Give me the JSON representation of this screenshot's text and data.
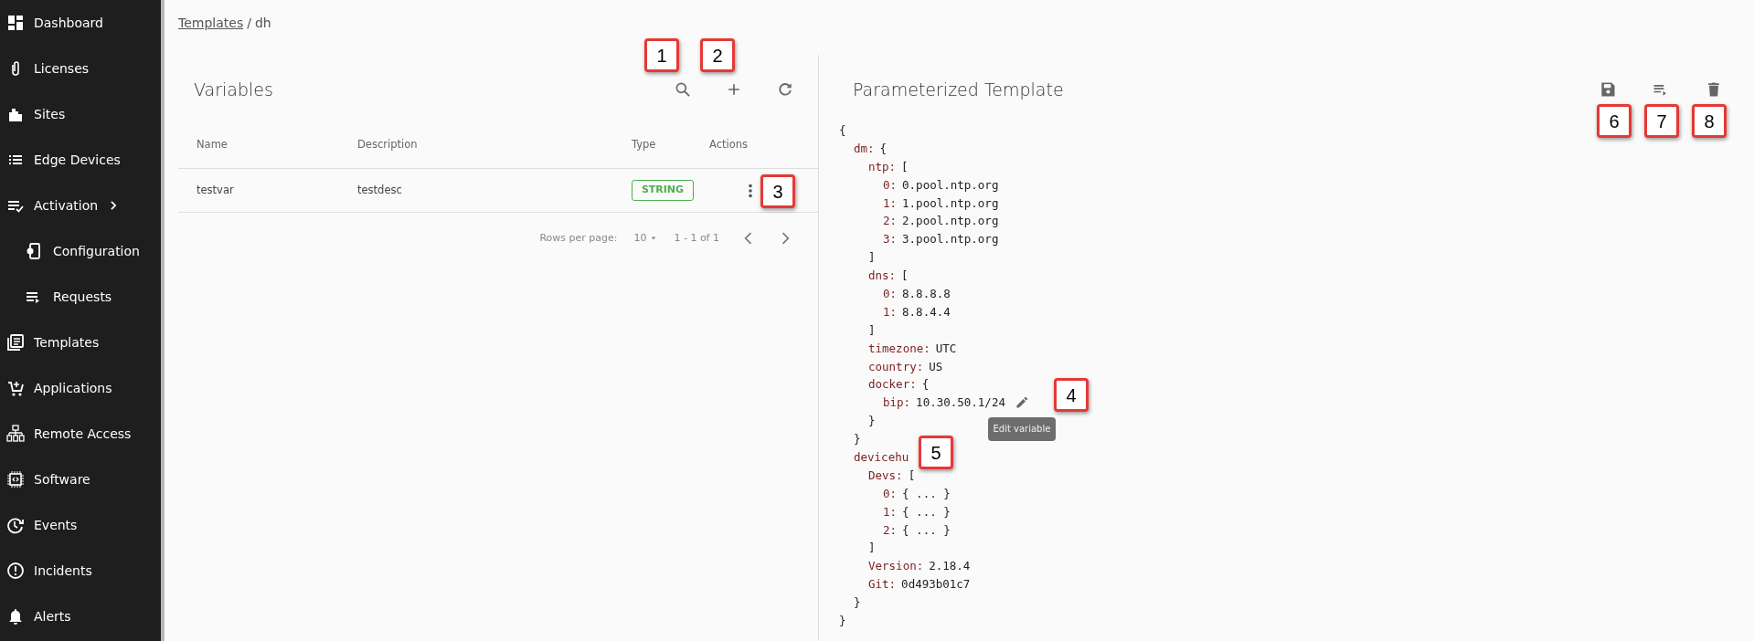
{
  "sidebar": {
    "items": [
      {
        "label": "Dashboard"
      },
      {
        "label": "Licenses"
      },
      {
        "label": "Sites"
      },
      {
        "label": "Edge Devices"
      },
      {
        "label": "Activation",
        "expanded": true,
        "children": [
          {
            "label": "Configuration"
          },
          {
            "label": "Requests"
          }
        ]
      },
      {
        "label": "Templates"
      },
      {
        "label": "Applications"
      },
      {
        "label": "Remote Access"
      },
      {
        "label": "Software"
      },
      {
        "label": "Events"
      },
      {
        "label": "Incidents"
      },
      {
        "label": "Alerts"
      }
    ]
  },
  "breadcrumb": {
    "link": "Templates",
    "separator": "/",
    "current": "dh"
  },
  "variables": {
    "title": "Variables",
    "columns": [
      "Name",
      "Description",
      "Type",
      "Actions"
    ],
    "rows": [
      {
        "name": "testvar",
        "description": "testdesc",
        "type": "STRING"
      }
    ],
    "pagination": {
      "rows_per_page_label": "Rows per page:",
      "rows_per_page": "10",
      "range": "1 - 1 of 1"
    }
  },
  "template": {
    "title": "Parameterized Template",
    "tree": {
      "open": "{",
      "close": "}",
      "children": [
        {
          "key": "dm:",
          "open": "{",
          "close": "}",
          "children": [
            {
              "key": "ntp:",
              "open": "[",
              "close": "]",
              "children": [
                {
                  "key": "0:",
                  "value": "0.pool.ntp.org"
                },
                {
                  "key": "1:",
                  "value": "1.pool.ntp.org"
                },
                {
                  "key": "2:",
                  "value": "2.pool.ntp.org"
                },
                {
                  "key": "3:",
                  "value": "3.pool.ntp.org"
                }
              ]
            },
            {
              "key": "dns:",
              "open": "[",
              "close": "]",
              "children": [
                {
                  "key": "0:",
                  "value": "8.8.8.8"
                },
                {
                  "key": "1:",
                  "value": "8.8.4.4"
                }
              ]
            },
            {
              "key": "timezone:",
              "value": "UTC"
            },
            {
              "key": "country:",
              "value": "US"
            },
            {
              "key": "docker:",
              "open": "{",
              "close": "}",
              "children": [
                {
                  "key": "bip:",
                  "value": "10.30.50.1/24",
                  "editable": true,
                  "tooltip": "Edit variable"
                }
              ]
            }
          ]
        },
        {
          "key": "devicehu",
          "close": "}",
          "children": [
            {
              "key": "Devs:",
              "open": "[",
              "close": "]",
              "children": [
                {
                  "key": "0:",
                  "value": "{ ... }"
                },
                {
                  "key": "1:",
                  "value": "{ ... }"
                },
                {
                  "key": "2:",
                  "value": "{ ... }"
                }
              ]
            },
            {
              "key": "Version:",
              "value": "2.18.4"
            },
            {
              "key": "Git:",
              "value": "0d493b01c7"
            }
          ]
        }
      ]
    }
  },
  "callouts": [
    "1",
    "2",
    "3",
    "4",
    "5",
    "6",
    "7",
    "8"
  ]
}
